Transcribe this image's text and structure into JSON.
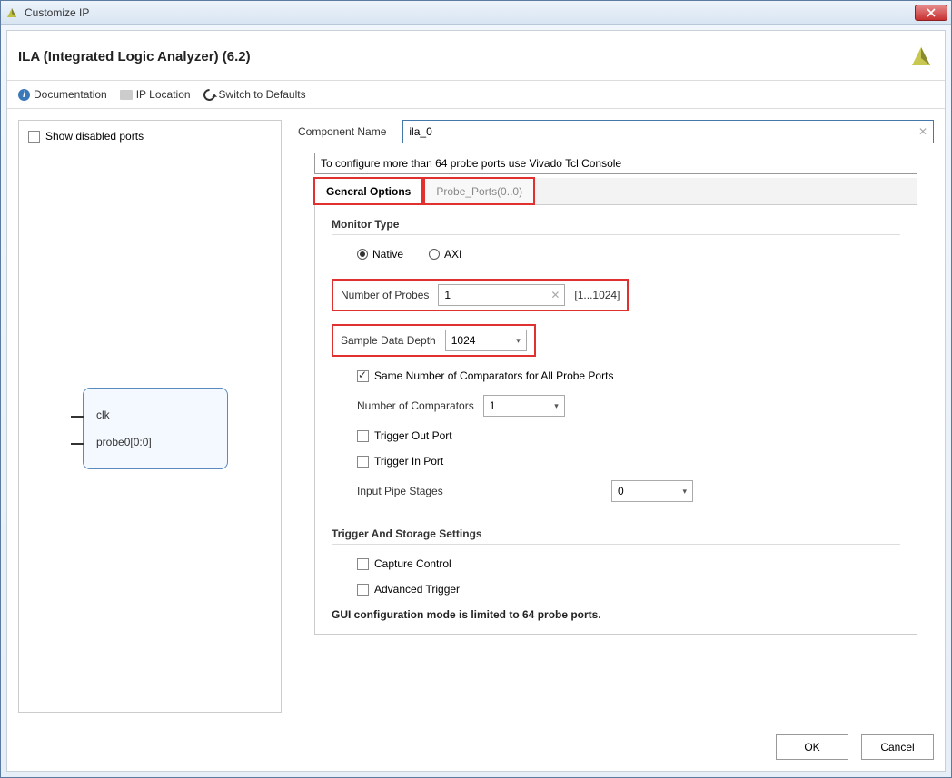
{
  "window": {
    "title": "Customize IP"
  },
  "header": {
    "title": "ILA (Integrated Logic Analyzer) (6.2)"
  },
  "toolbar": {
    "documentation": "Documentation",
    "ip_location": "IP Location",
    "switch_defaults": "Switch to Defaults"
  },
  "left": {
    "show_disabled": "Show disabled ports",
    "ports": {
      "clk": "clk",
      "probe0": "probe0[0:0]"
    }
  },
  "form": {
    "component_name_label": "Component Name",
    "component_name_value": "ila_0",
    "info_line": "To configure more than 64 probe ports use Vivado Tcl Console",
    "tabs": {
      "general": "General Options",
      "probe_ports": "Probe_Ports(0..0)"
    },
    "monitor_type_title": "Monitor Type",
    "monitor_native": "Native",
    "monitor_axi": "AXI",
    "num_probes_label": "Number of Probes",
    "num_probes_value": "1",
    "num_probes_range": "[1...1024]",
    "sample_depth_label": "Sample Data Depth",
    "sample_depth_value": "1024",
    "same_comparators": "Same Number of Comparators for All Probe Ports",
    "num_comparators_label": "Number of Comparators",
    "num_comparators_value": "1",
    "trigger_out": "Trigger Out Port",
    "trigger_in": "Trigger In Port",
    "input_pipe_label": "Input Pipe Stages",
    "input_pipe_value": "0",
    "trigger_storage_title": "Trigger And Storage Settings",
    "capture_control": "Capture Control",
    "advanced_trigger": "Advanced Trigger",
    "footer_note": "GUI configuration mode is limited to 64 probe ports."
  },
  "buttons": {
    "ok": "OK",
    "cancel": "Cancel"
  }
}
